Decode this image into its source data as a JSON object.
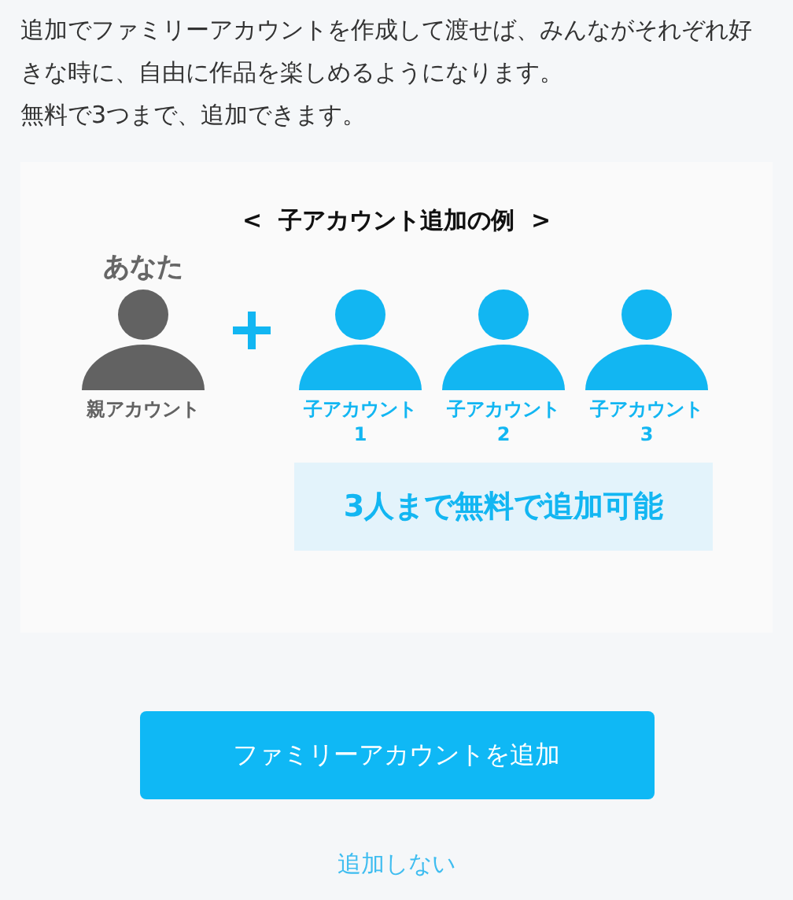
{
  "intro": [
    "追加でファミリーアカウントを作成して渡せば、みんながそれぞれ好きな時に、自由に作品を楽しめるようになります。",
    "無料で3つまで、追加できます。"
  ],
  "example": {
    "title": "<  子アカウント追加の例  >",
    "heading": "あなた",
    "accounts": [
      {
        "kind": "parent",
        "label": "親アカウント"
      },
      {
        "kind": "child",
        "label": "子アカウント",
        "number": "1"
      },
      {
        "kind": "child",
        "label": "子アカウント",
        "number": "2"
      },
      {
        "kind": "child",
        "label": "子アカウント",
        "number": "3"
      }
    ],
    "badge": "3人まで無料で追加可能"
  },
  "primary_button": "ファミリーアカウントを追加",
  "secondary_link": "追加しない"
}
